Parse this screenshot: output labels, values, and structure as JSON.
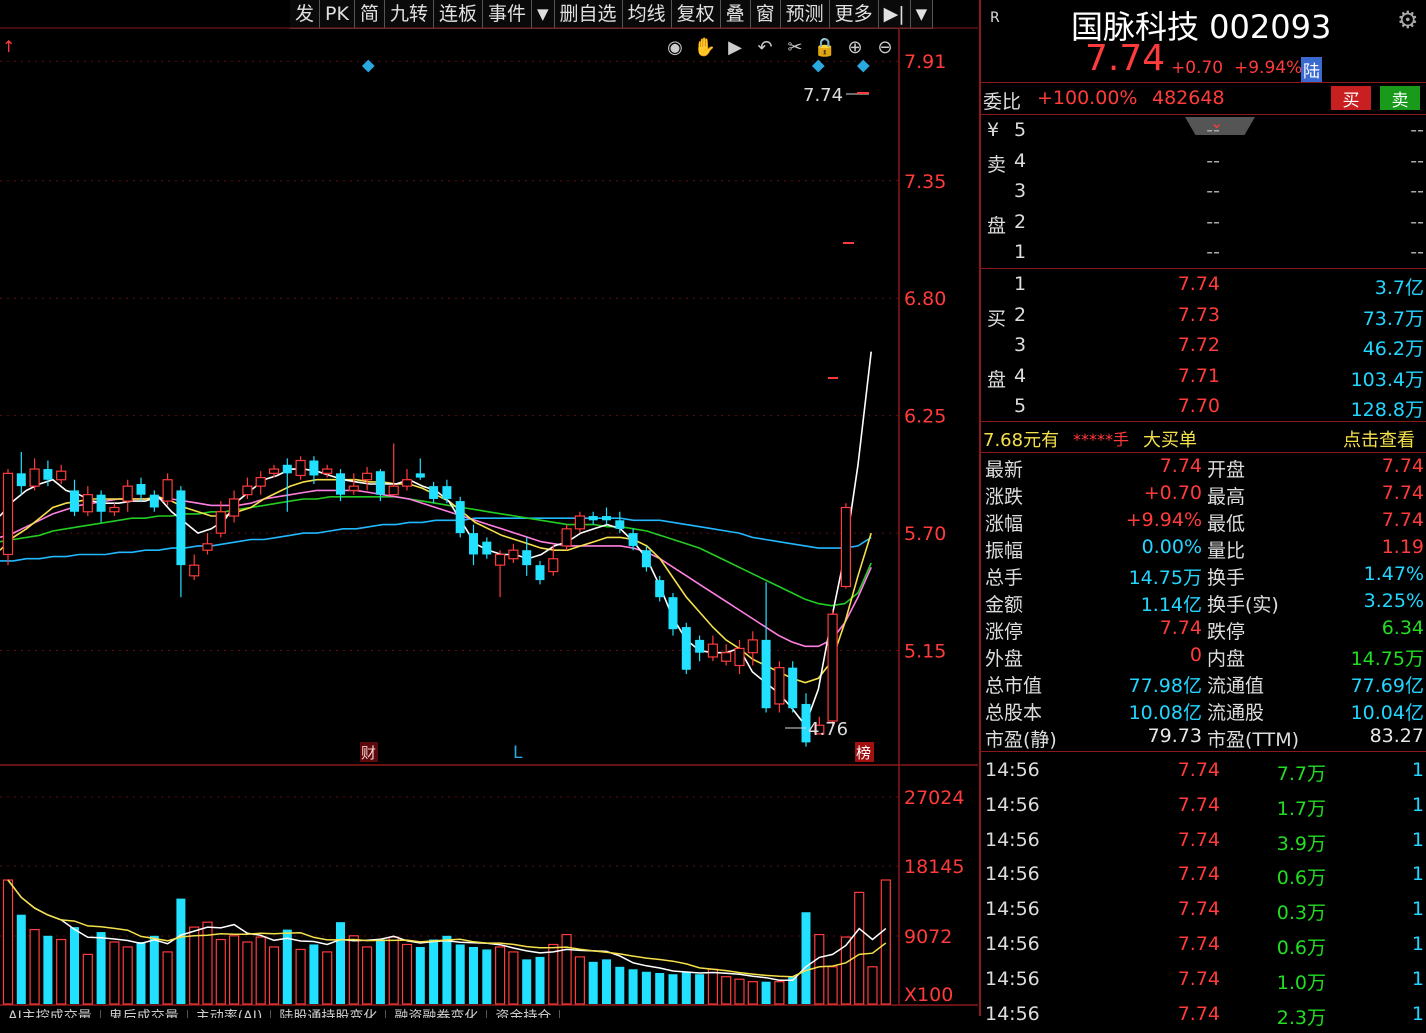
{
  "toolbar": [
    {
      "label": "发",
      "name": "toolbar-fa"
    },
    {
      "label": "PK",
      "name": "toolbar-pk"
    },
    {
      "label": "简",
      "name": "toolbar-jian"
    },
    {
      "label": "九转",
      "name": "toolbar-jiuzhuan"
    },
    {
      "label": "连板",
      "name": "toolbar-lianban"
    },
    {
      "label": "事件",
      "name": "toolbar-events"
    },
    {
      "label": "▼",
      "name": "toolbar-dropdown"
    },
    {
      "label": "删自选",
      "name": "toolbar-remove-watchlist"
    },
    {
      "label": "均线",
      "name": "toolbar-ma"
    },
    {
      "label": "复权",
      "name": "toolbar-fuquan"
    },
    {
      "label": "叠",
      "name": "toolbar-overlay"
    },
    {
      "label": "窗",
      "name": "toolbar-window"
    },
    {
      "label": "预测",
      "name": "toolbar-forecast"
    },
    {
      "label": "更多",
      "name": "toolbar-more"
    },
    {
      "label": "▶|",
      "name": "toolbar-collapse"
    },
    {
      "label": "▼",
      "name": "toolbar-menu"
    }
  ],
  "chart_tools": [
    "eye-icon",
    "hand-icon",
    "play-icon",
    "undo-icon",
    "scissors-icon",
    "lock-icon",
    "zoom-in-icon",
    "zoom-out-icon"
  ],
  "price_axis": [
    "7.91",
    "7.35",
    "6.80",
    "6.25",
    "5.70",
    "5.15"
  ],
  "volume_axis": [
    "27024",
    "18145",
    "9072",
    "X100"
  ],
  "annotations": {
    "high": "7.74",
    "low": "4.76",
    "cai": "财",
    "L": "L",
    "bang": "榜",
    "up_arrow": "↑"
  },
  "stock": {
    "r_label": "R",
    "name_code": "国脉科技 002093",
    "price": "7.74",
    "change": "+0.70",
    "change_pct": "+9.94%",
    "tag": "陆"
  },
  "weibi": {
    "label": "委比",
    "pct": "+100.00%",
    "value": "482648",
    "buy": "买",
    "sell": "卖"
  },
  "sell_book": {
    "side": [
      "¥",
      "卖",
      "",
      "盘",
      ""
    ],
    "rows": [
      {
        "lvl": "5",
        "price": "--",
        "vol": "--"
      },
      {
        "lvl": "4",
        "price": "--",
        "vol": "--"
      },
      {
        "lvl": "3",
        "price": "--",
        "vol": "--"
      },
      {
        "lvl": "2",
        "price": "--",
        "vol": "--"
      },
      {
        "lvl": "1",
        "price": "--",
        "vol": "--"
      }
    ]
  },
  "buy_book": {
    "side": [
      "",
      "买",
      "",
      "盘",
      ""
    ],
    "rows": [
      {
        "lvl": "1",
        "price": "7.74",
        "vol": "3.7亿"
      },
      {
        "lvl": "2",
        "price": "7.73",
        "vol": "73.7万"
      },
      {
        "lvl": "3",
        "price": "7.72",
        "vol": "46.2万"
      },
      {
        "lvl": "4",
        "price": "7.71",
        "vol": "103.4万"
      },
      {
        "lvl": "5",
        "price": "7.70",
        "vol": "128.8万"
      }
    ]
  },
  "big_order": {
    "price": "7.68元有",
    "qty": "*****手",
    "label": "大买单",
    "link": "点击查看"
  },
  "stats": [
    {
      "l1": "最新",
      "v1": "7.74",
      "c1": "red",
      "l2": "开盘",
      "v2": "7.74",
      "c2": "red"
    },
    {
      "l1": "涨跌",
      "v1": "+0.70",
      "c1": "red",
      "l2": "最高",
      "v2": "7.74",
      "c2": "red"
    },
    {
      "l1": "涨幅",
      "v1": "+9.94%",
      "c1": "red",
      "l2": "最低",
      "v2": "7.74",
      "c2": "red"
    },
    {
      "l1": "振幅",
      "v1": "0.00%",
      "c1": "cyan",
      "l2": "量比",
      "v2": "1.19",
      "c2": "red"
    },
    {
      "l1": "总手",
      "v1": "14.75万",
      "c1": "cyan",
      "l2": "换手",
      "v2": "1.47%",
      "c2": "cyan"
    },
    {
      "l1": "金额",
      "v1": "1.14亿",
      "c1": "cyan",
      "l2": "换手(实)",
      "v2": "3.25%",
      "c2": "cyan"
    },
    {
      "l1": "涨停",
      "v1": "7.74",
      "c1": "red",
      "l2": "跌停",
      "v2": "6.34",
      "c2": "green"
    },
    {
      "l1": "外盘",
      "v1": "0",
      "c1": "red",
      "l2": "内盘",
      "v2": "14.75万",
      "c2": "green"
    },
    {
      "l1": "总市值",
      "v1": "77.98亿",
      "c1": "cyan",
      "l2": "流通值",
      "v2": "77.69亿",
      "c2": "cyan"
    },
    {
      "l1": "总股本",
      "v1": "10.08亿",
      "c1": "cyan",
      "l2": "流通股",
      "v2": "10.04亿",
      "c2": "cyan"
    },
    {
      "l1": "市盈(静)",
      "v1": "79.73",
      "c1": "white",
      "l2": "市盈(TTM)",
      "v2": "83.27",
      "c2": "white"
    }
  ],
  "ticks": [
    {
      "time": "14:56",
      "price": "7.74",
      "vol": "7.7万",
      "n": "1"
    },
    {
      "time": "14:56",
      "price": "7.74",
      "vol": "1.7万",
      "n": "1"
    },
    {
      "time": "14:56",
      "price": "7.74",
      "vol": "3.9万",
      "n": "1"
    },
    {
      "time": "14:56",
      "price": "7.74",
      "vol": "0.6万",
      "n": "1"
    },
    {
      "time": "14:56",
      "price": "7.74",
      "vol": "0.3万",
      "n": "1"
    },
    {
      "time": "14:56",
      "price": "7.74",
      "vol": "0.6万",
      "n": "1"
    },
    {
      "time": "14:56",
      "price": "7.74",
      "vol": "1.0万",
      "n": "1"
    },
    {
      "time": "14:56",
      "price": "7.74",
      "vol": "2.3万",
      "n": "1"
    }
  ],
  "bottom_tabs": [
    "AI主控成交量",
    "鬼后成交量",
    "主动率(AI)",
    "陆股通持股变化",
    "融资融券变化",
    "资金持仓"
  ],
  "colors": {
    "up": "#ff3b3b",
    "down": "#22e0ff",
    "ma5": "#ffffff",
    "ma10": "#f5e04a",
    "ma20": "#ff7fe0",
    "ma30": "#22cc22",
    "ma60": "#22b8ff"
  },
  "chart_data": {
    "type": "candlestick",
    "ylim": [
      4.6,
      8.0
    ],
    "candles": [
      [
        5.6,
        5.98,
        6.0,
        5.55
      ],
      [
        5.98,
        5.92,
        6.08,
        5.88
      ],
      [
        5.92,
        6.0,
        6.05,
        5.9
      ],
      [
        6.0,
        5.95,
        6.04,
        5.92
      ],
      [
        5.95,
        5.99,
        6.02,
        5.93
      ],
      [
        5.9,
        5.8,
        5.95,
        5.78
      ],
      [
        5.8,
        5.88,
        5.92,
        5.78
      ],
      [
        5.88,
        5.8,
        5.9,
        5.75
      ],
      [
        5.8,
        5.82,
        5.84,
        5.78
      ],
      [
        5.85,
        5.92,
        5.95,
        5.8
      ],
      [
        5.93,
        5.88,
        5.96,
        5.85
      ],
      [
        5.88,
        5.82,
        5.9,
        5.8
      ],
      [
        5.85,
        5.95,
        5.98,
        5.83
      ],
      [
        5.9,
        5.55,
        5.92,
        5.4
      ],
      [
        5.5,
        5.55,
        5.6,
        5.48
      ],
      [
        5.62,
        5.65,
        5.7,
        5.6
      ],
      [
        5.7,
        5.8,
        5.85,
        5.68
      ],
      [
        5.78,
        5.86,
        5.9,
        5.75
      ],
      [
        5.88,
        5.92,
        5.96,
        5.86
      ],
      [
        5.92,
        5.96,
        5.99,
        5.88
      ],
      [
        5.98,
        6.0,
        6.02,
        5.96
      ],
      [
        6.02,
        5.98,
        6.05,
        5.8
      ],
      [
        5.97,
        6.04,
        6.06,
        5.95
      ],
      [
        6.04,
        5.97,
        6.06,
        5.93
      ],
      [
        5.98,
        6.0,
        6.02,
        5.96
      ],
      [
        5.98,
        5.88,
        6.0,
        5.85
      ],
      [
        5.9,
        5.92,
        5.98,
        5.88
      ],
      [
        5.95,
        5.98,
        6.01,
        5.9
      ],
      [
        5.99,
        5.88,
        6.0,
        5.85
      ],
      [
        5.88,
        5.92,
        6.12,
        5.88
      ],
      [
        5.92,
        5.95,
        6.0,
        5.9
      ],
      [
        5.98,
        5.96,
        6.05,
        5.95
      ],
      [
        5.92,
        5.86,
        5.94,
        5.84
      ],
      [
        5.92,
        5.86,
        5.95,
        5.84
      ],
      [
        5.85,
        5.7,
        5.87,
        5.68
      ],
      [
        5.7,
        5.6,
        5.74,
        5.55
      ],
      [
        5.66,
        5.6,
        5.68,
        5.58
      ],
      [
        5.55,
        5.6,
        5.62,
        5.4
      ],
      [
        5.58,
        5.62,
        5.65,
        5.56
      ],
      [
        5.62,
        5.55,
        5.68,
        5.5
      ],
      [
        5.55,
        5.48,
        5.57,
        5.46
      ],
      [
        5.52,
        5.58,
        5.64,
        5.5
      ],
      [
        5.64,
        5.72,
        5.74,
        5.62
      ],
      [
        5.72,
        5.78,
        5.8,
        5.7
      ],
      [
        5.78,
        5.76,
        5.8,
        5.74
      ],
      [
        5.78,
        5.76,
        5.82,
        5.74
      ],
      [
        5.76,
        5.72,
        5.8,
        5.7
      ],
      [
        5.7,
        5.64,
        5.72,
        5.62
      ],
      [
        5.62,
        5.54,
        5.64,
        5.52
      ],
      [
        5.48,
        5.4,
        5.5,
        5.38
      ],
      [
        5.4,
        5.25,
        5.42,
        5.22
      ],
      [
        5.26,
        5.06,
        5.28,
        5.04
      ],
      [
        5.2,
        5.14,
        5.22,
        5.1
      ],
      [
        5.12,
        5.18,
        5.22,
        5.1
      ],
      [
        5.1,
        5.14,
        5.18,
        5.08
      ],
      [
        5.08,
        5.16,
        5.2,
        5.04
      ],
      [
        5.14,
        5.2,
        5.24,
        5.08
      ],
      [
        5.2,
        4.88,
        5.47,
        4.86
      ],
      [
        4.9,
        5.07,
        5.1,
        4.86
      ],
      [
        5.07,
        4.88,
        5.1,
        4.86
      ],
      [
        4.9,
        4.72,
        4.95,
        4.7
      ],
      [
        4.76,
        4.8,
        4.84,
        4.76
      ],
      [
        4.82,
        5.32,
        5.34,
        4.8
      ],
      [
        5.45,
        5.82,
        5.84,
        5.44
      ]
    ],
    "ma5": [
      5.78,
      5.85,
      5.9,
      5.93,
      5.95,
      5.9,
      5.88,
      5.85,
      5.84,
      5.84,
      5.85,
      5.85,
      5.87,
      5.8,
      5.75,
      5.7,
      5.72,
      5.76,
      5.85,
      5.9,
      5.95,
      5.97,
      6.0,
      6.0,
      5.99,
      5.97,
      5.95,
      5.94,
      5.93,
      5.93,
      5.93,
      5.95,
      5.92,
      5.9,
      5.85,
      5.75,
      5.65,
      5.62,
      5.6,
      5.6,
      5.58,
      5.6,
      5.64,
      5.66,
      5.7,
      5.72,
      5.74,
      5.72,
      5.66,
      5.58,
      5.45,
      5.3,
      5.2,
      5.15,
      5.14,
      5.14,
      5.16,
      5.05,
      5.0,
      4.95,
      4.88,
      4.8,
      4.97,
      5.3,
      5.6,
      6.02,
      6.55
    ],
    "ma10": [
      5.62,
      5.68,
      5.72,
      5.77,
      5.82,
      5.84,
      5.85,
      5.86,
      5.86,
      5.86,
      5.86,
      5.86,
      5.87,
      5.85,
      5.82,
      5.8,
      5.78,
      5.78,
      5.8,
      5.82,
      5.86,
      5.89,
      5.92,
      5.94,
      5.95,
      5.95,
      5.95,
      5.95,
      5.94,
      5.94,
      5.93,
      5.93,
      5.91,
      5.88,
      5.85,
      5.8,
      5.75,
      5.72,
      5.69,
      5.67,
      5.65,
      5.63,
      5.62,
      5.62,
      5.64,
      5.66,
      5.68,
      5.68,
      5.67,
      5.64,
      5.58,
      5.49,
      5.4,
      5.33,
      5.26,
      5.2,
      5.16,
      5.11,
      5.08,
      5.05,
      5.02,
      5.0,
      5.02,
      5.1,
      5.28,
      5.5,
      5.7
    ],
    "ma20": [
      5.68,
      5.7,
      5.73,
      5.76,
      5.79,
      5.81,
      5.83,
      5.84,
      5.85,
      5.86,
      5.86,
      5.86,
      5.86,
      5.86,
      5.85,
      5.84,
      5.83,
      5.83,
      5.83,
      5.84,
      5.86,
      5.87,
      5.88,
      5.89,
      5.9,
      5.9,
      5.9,
      5.9,
      5.89,
      5.88,
      5.87,
      5.86,
      5.84,
      5.82,
      5.8,
      5.78,
      5.76,
      5.74,
      5.72,
      5.7,
      5.68,
      5.66,
      5.65,
      5.64,
      5.64,
      5.64,
      5.64,
      5.64,
      5.63,
      5.61,
      5.58,
      5.54,
      5.5,
      5.46,
      5.42,
      5.38,
      5.34,
      5.3,
      5.26,
      5.22,
      5.19,
      5.17,
      5.17,
      5.2,
      5.28,
      5.4,
      5.54
    ],
    "ma30": [
      5.66,
      5.67,
      5.68,
      5.69,
      5.71,
      5.72,
      5.73,
      5.74,
      5.75,
      5.76,
      5.77,
      5.77,
      5.78,
      5.78,
      5.79,
      5.79,
      5.8,
      5.8,
      5.81,
      5.82,
      5.83,
      5.84,
      5.85,
      5.86,
      5.86,
      5.87,
      5.87,
      5.87,
      5.87,
      5.87,
      5.87,
      5.86,
      5.85,
      5.84,
      5.83,
      5.82,
      5.81,
      5.8,
      5.79,
      5.78,
      5.77,
      5.76,
      5.75,
      5.74,
      5.74,
      5.74,
      5.73,
      5.73,
      5.72,
      5.71,
      5.69,
      5.67,
      5.65,
      5.63,
      5.6,
      5.57,
      5.54,
      5.51,
      5.48,
      5.45,
      5.42,
      5.39,
      5.37,
      5.36,
      5.37,
      5.42,
      5.56
    ],
    "ma60": [
      5.57,
      5.57,
      5.58,
      5.58,
      5.59,
      5.59,
      5.6,
      5.6,
      5.6,
      5.61,
      5.61,
      5.62,
      5.62,
      5.63,
      5.63,
      5.64,
      5.64,
      5.65,
      5.66,
      5.67,
      5.67,
      5.68,
      5.69,
      5.7,
      5.7,
      5.71,
      5.72,
      5.72,
      5.73,
      5.74,
      5.74,
      5.75,
      5.75,
      5.76,
      5.76,
      5.76,
      5.77,
      5.77,
      5.77,
      5.77,
      5.77,
      5.77,
      5.77,
      5.77,
      5.77,
      5.77,
      5.77,
      5.77,
      5.76,
      5.76,
      5.76,
      5.75,
      5.74,
      5.73,
      5.72,
      5.71,
      5.7,
      5.68,
      5.67,
      5.66,
      5.65,
      5.64,
      5.63,
      5.63,
      5.63,
      5.64,
      5.68
    ],
    "volumes": [
      100,
      72,
      60,
      55,
      52,
      62,
      40,
      58,
      50,
      46,
      50,
      55,
      42,
      85,
      62,
      66,
      52,
      55,
      50,
      54,
      46,
      60,
      44,
      48,
      42,
      66,
      55,
      46,
      52,
      54,
      48,
      46,
      52,
      55,
      48,
      46,
      44,
      46,
      42,
      36,
      38,
      48,
      56,
      38,
      34,
      36,
      30,
      28,
      26,
      25,
      24,
      26,
      24,
      28,
      22,
      20,
      18,
      18,
      18,
      22,
      74,
      56,
      30,
      54,
      90,
      30,
      100
    ],
    "vol_ylim": [
      0,
      300
    ]
  }
}
